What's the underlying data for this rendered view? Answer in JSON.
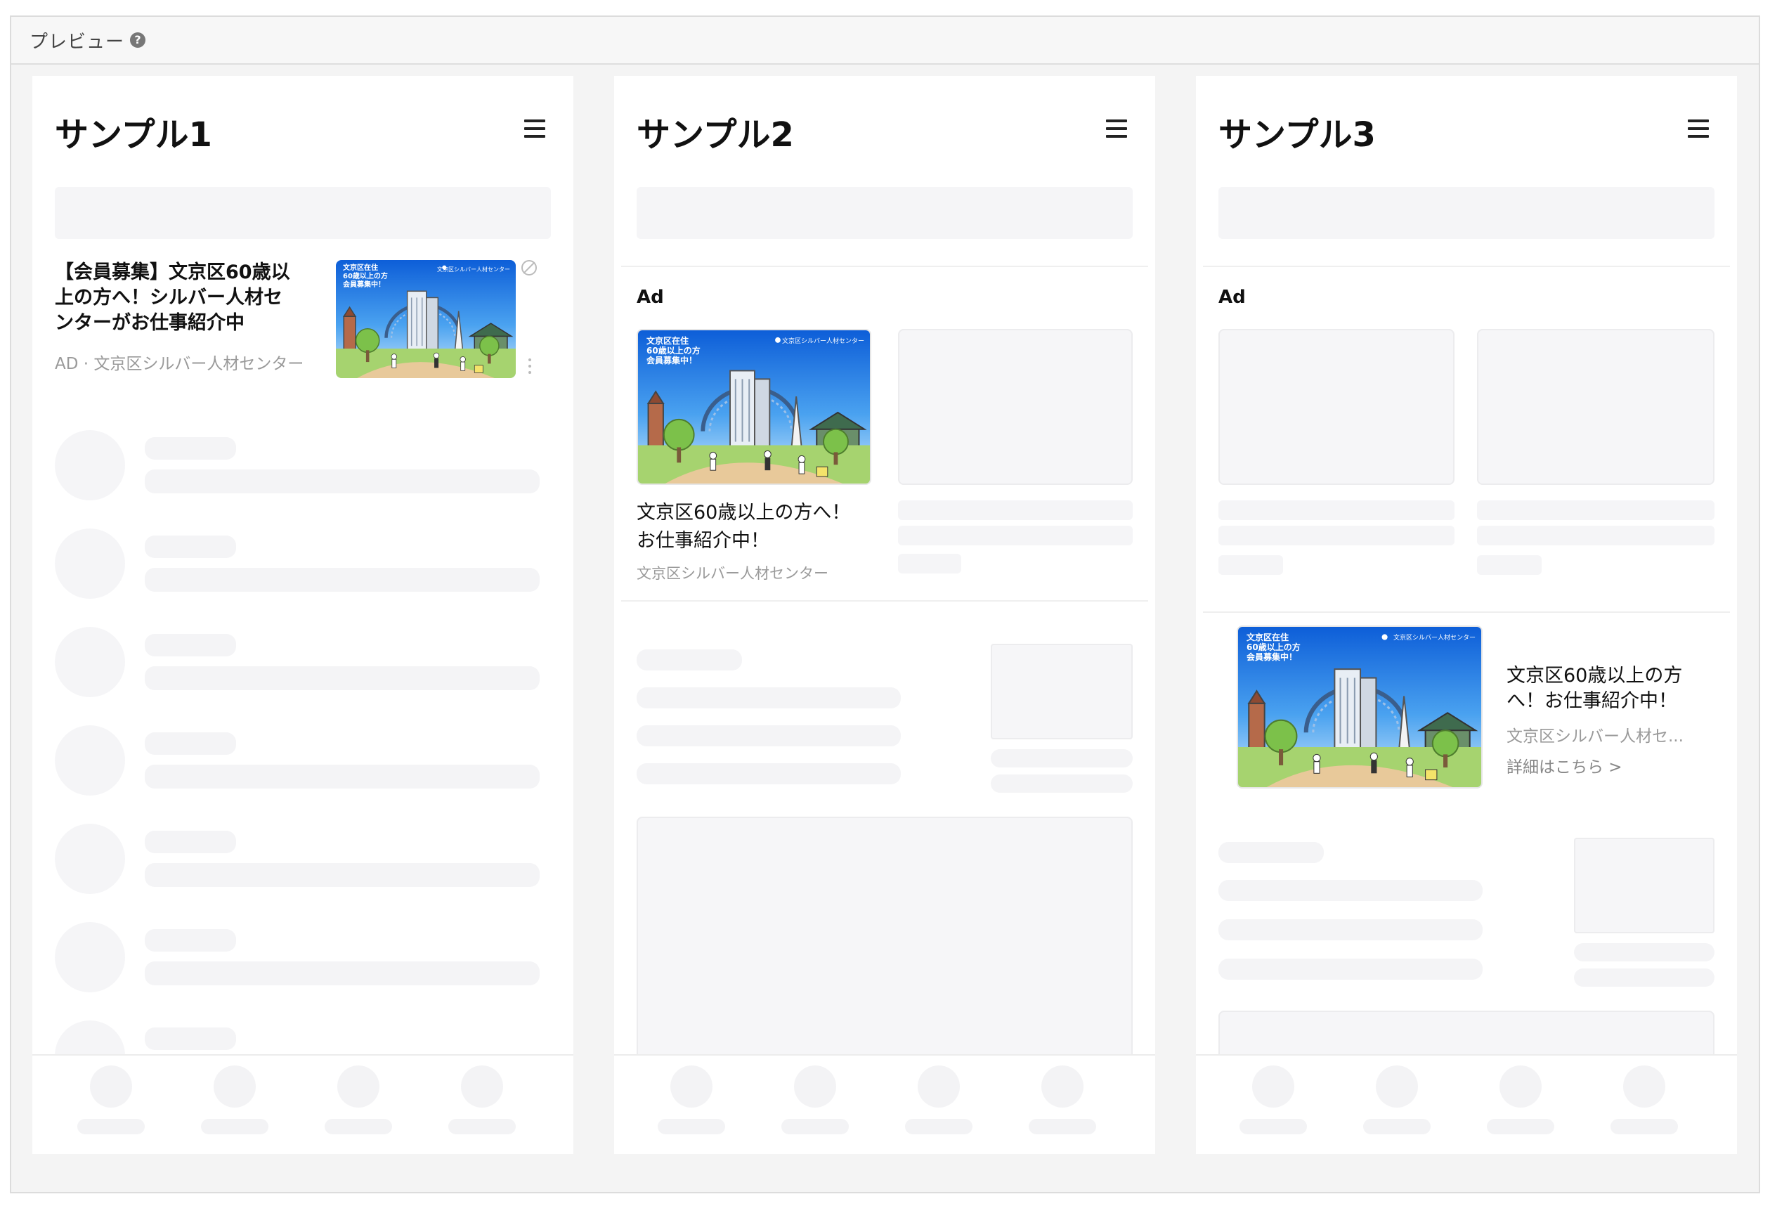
{
  "frame": {
    "title": "プレビュー",
    "help_icon": "question-circle-icon"
  },
  "panels": [
    {
      "title": "サンプル1",
      "ad": {
        "title": "【会員募集】文京区60歳以上の方へ！シルバー人材センターがお仕事紹介中",
        "source": "AD · 文京区シルバー人材センター"
      }
    },
    {
      "title": "サンプル2",
      "ad_label": "Ad",
      "ad": {
        "title": "文京区60歳以上の方へ！お仕事紹介中！",
        "source": "文京区シルバー人材センター"
      }
    },
    {
      "title": "サンプル3",
      "ad_label": "Ad",
      "ad": {
        "title": "文京区60歳以上の方へ！お仕事紹介中！",
        "source": "文京区シルバー人材セ...",
        "link": "詳細はこちら >"
      }
    }
  ],
  "banner": {
    "headline_1": "文京区在住",
    "headline_2": "60歳以上の方",
    "headline_3": "会員募集中！",
    "org": "文京区シルバー人材センター"
  },
  "colors": {
    "sky": "#1f6fe0",
    "grass": "#8cc152",
    "skeleton": "#f5f5f7"
  }
}
